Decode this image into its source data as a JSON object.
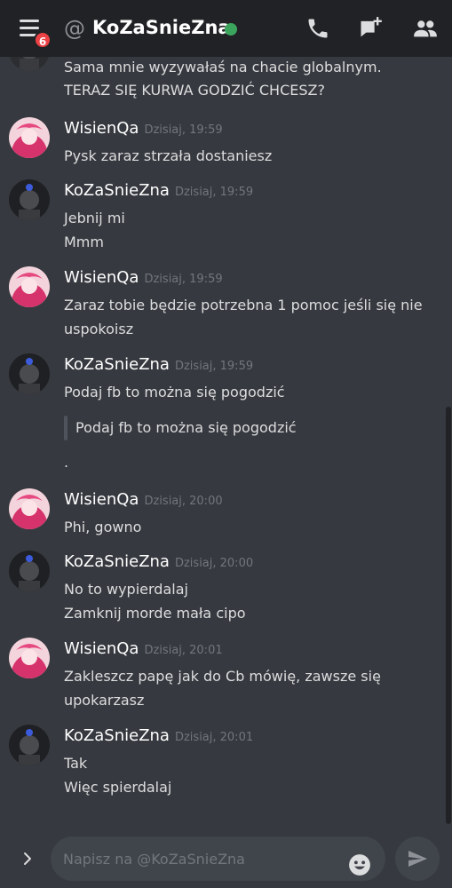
{
  "header": {
    "badge_count": "6",
    "at_symbol": "@",
    "title": "KoZaSnieZna",
    "status_color": "#3ba55d"
  },
  "messages": [
    {
      "continuation": true,
      "author": "KoZaSnieZna",
      "lines": [
        "Sama mnie wyzywałaś na chacie globalnym.",
        "TERAZ SIĘ KURWA GODZIĆ CHCESZ?"
      ]
    },
    {
      "author": "WisienQa",
      "timestamp": "Dzisiaj, 19:59",
      "lines": [
        "Pysk zaraz strzała dostaniesz"
      ]
    },
    {
      "author": "KoZaSnieZna",
      "timestamp": "Dzisiaj, 19:59",
      "lines": [
        "Jebnij mi",
        "Mmm"
      ]
    },
    {
      "author": "WisienQa",
      "timestamp": "Dzisiaj, 19:59",
      "lines": [
        "Zaraz tobie będzie potrzebna 1 pomoc jeśli się nie",
        "uspokoisz"
      ]
    },
    {
      "author": "KoZaSnieZna",
      "timestamp": "Dzisiaj, 19:59",
      "lines": [
        "Podaj fb to można się pogodzić"
      ],
      "quote": "Podaj fb to można się pogodzić",
      "after_quote": "."
    },
    {
      "author": "WisienQa",
      "timestamp": "Dzisiaj, 20:00",
      "lines": [
        "Phi, gowno"
      ]
    },
    {
      "author": "KoZaSnieZna",
      "timestamp": "Dzisiaj, 20:00",
      "lines": [
        "No to wypierdalaj",
        "Zamknij morde mała cipo"
      ]
    },
    {
      "author": "WisienQa",
      "timestamp": "Dzisiaj, 20:01",
      "lines": [
        "Zakleszcz papę jak do Cb mówię, zawsze się",
        "upokarzasz"
      ]
    },
    {
      "author": "KoZaSnieZna",
      "timestamp": "Dzisiaj, 20:01",
      "lines": [
        "Tak",
        "Więc spierdalaj"
      ]
    }
  ],
  "composer": {
    "placeholder": "Napisz na @KoZaSnieZna"
  },
  "colors": {
    "background": "#36393f",
    "header": "#202225",
    "badge": "#ed4245",
    "input": "#40444b"
  },
  "icons": [
    "menu-icon",
    "at-icon",
    "phone-icon",
    "new-dm-icon",
    "members-icon",
    "expand-icon",
    "emoji-icon",
    "send-icon"
  ]
}
